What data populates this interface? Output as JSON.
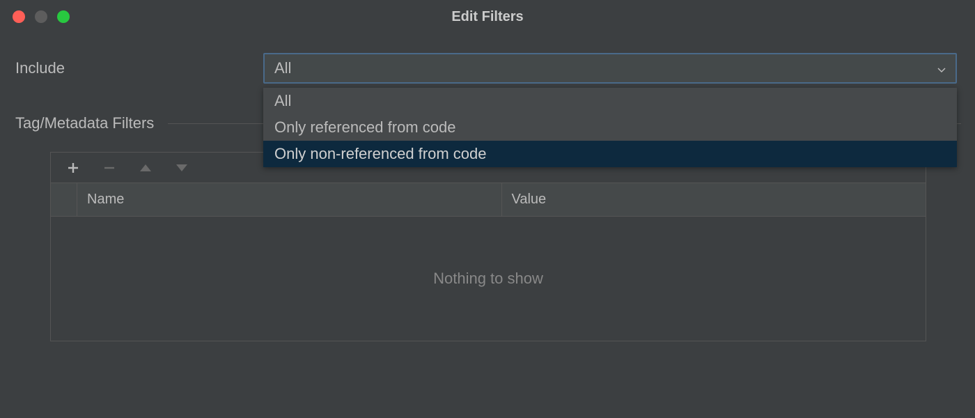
{
  "window": {
    "title": "Edit Filters"
  },
  "form": {
    "include_label": "Include",
    "include_value": "All",
    "include_options": [
      "All",
      "Only referenced from code",
      "Only non-referenced from code"
    ],
    "filters_section_label": "Tag/Metadata Filters"
  },
  "table": {
    "columns": {
      "name": "Name",
      "value": "Value"
    },
    "empty_message": "Nothing to show"
  }
}
